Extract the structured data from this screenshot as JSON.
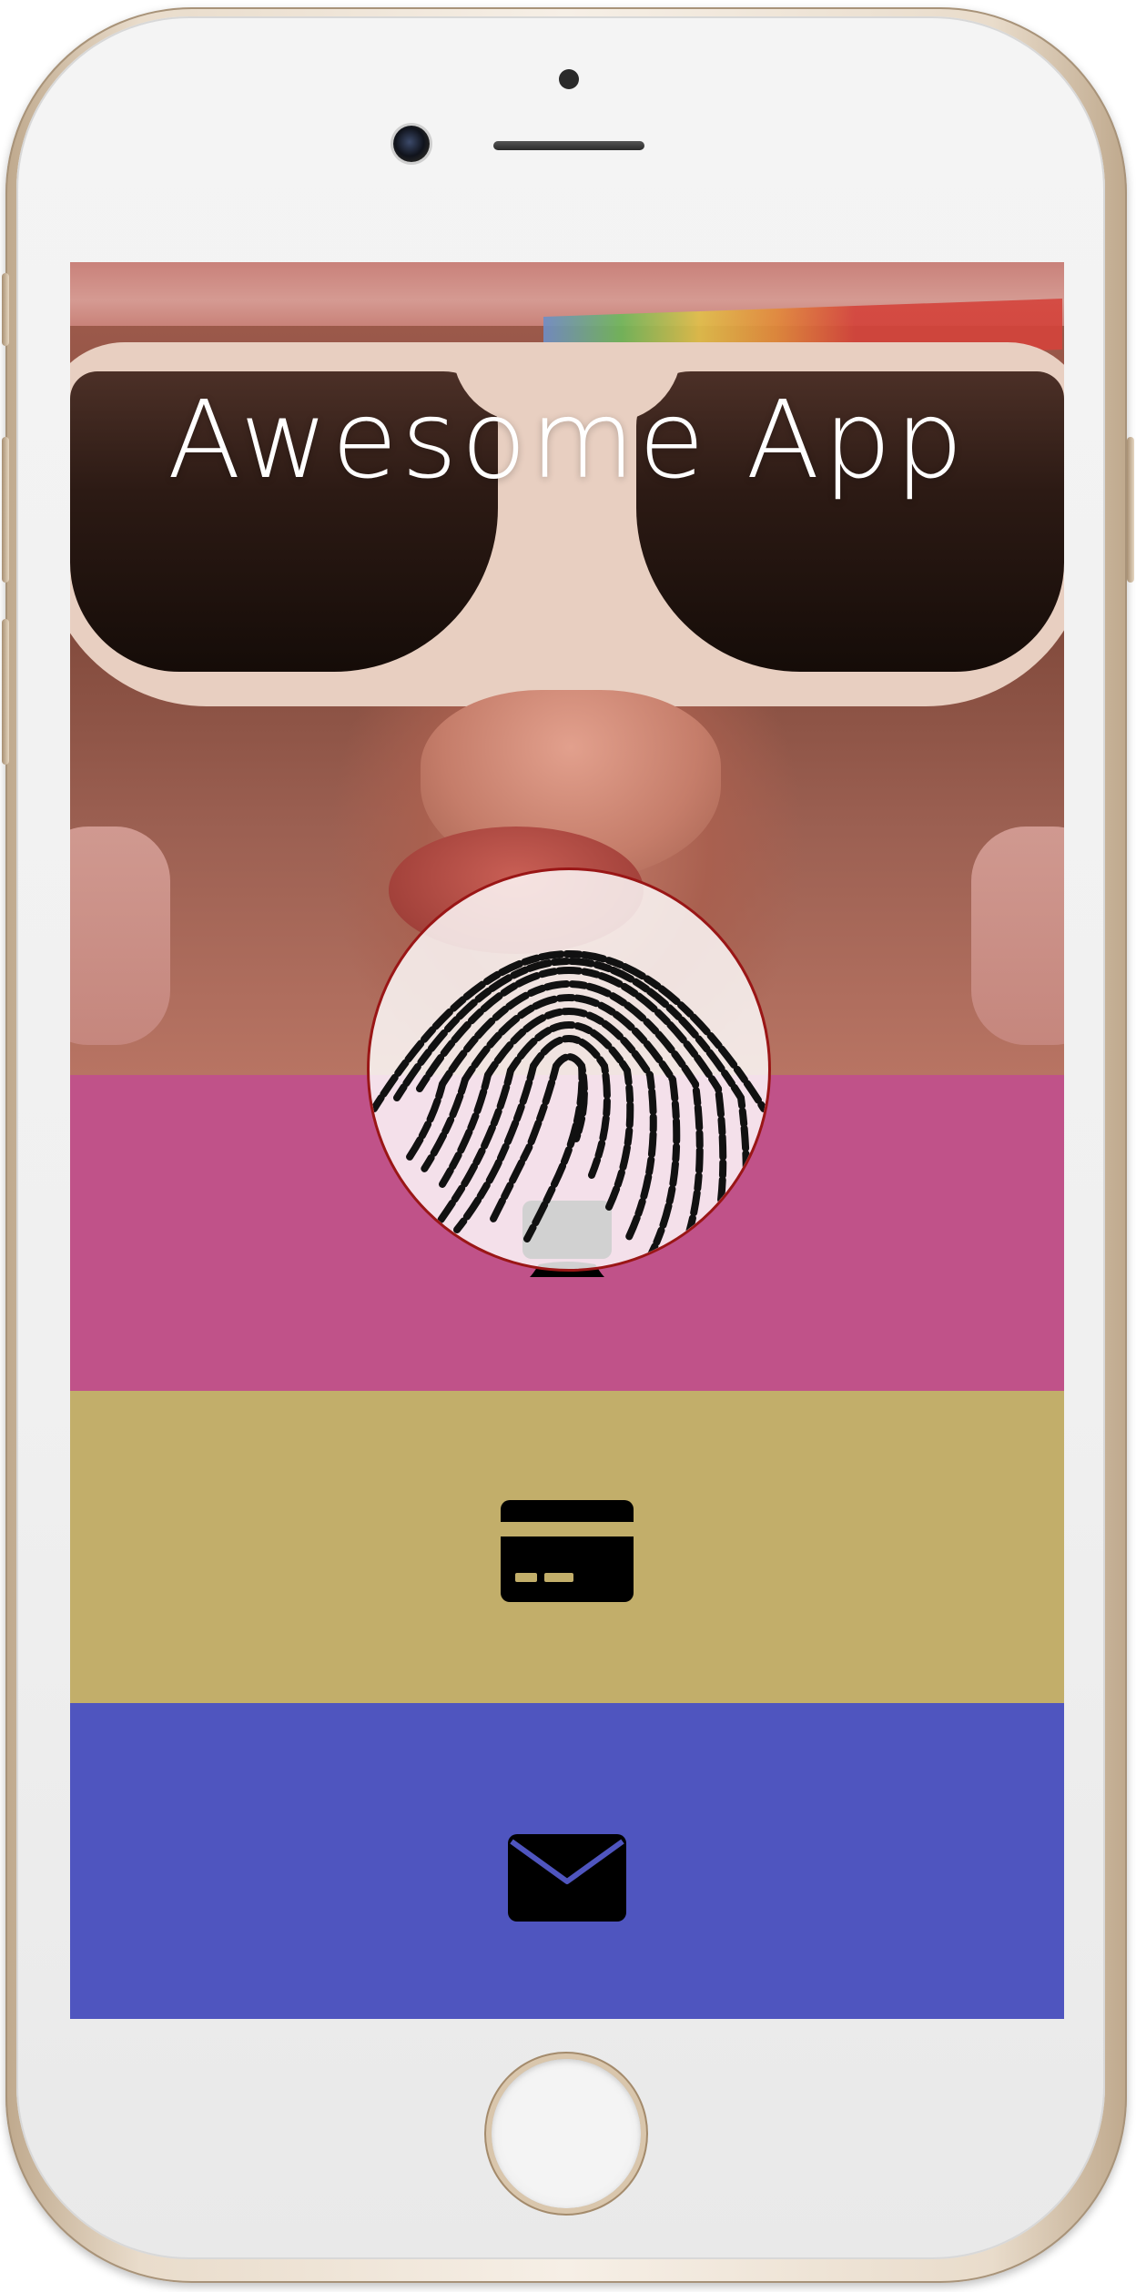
{
  "app": {
    "title": "Awesome App"
  },
  "bands": [
    {
      "name": "monitor",
      "color": "#c05289",
      "icon": "monitor-icon"
    },
    {
      "name": "card",
      "color": "#c2ae6a",
      "icon": "credit-card-icon"
    },
    {
      "name": "mail",
      "color": "#4f55bf",
      "icon": "mail-icon"
    }
  ],
  "fingerprint": {
    "icon": "fingerprint-icon",
    "border_color": "#9a1616"
  }
}
